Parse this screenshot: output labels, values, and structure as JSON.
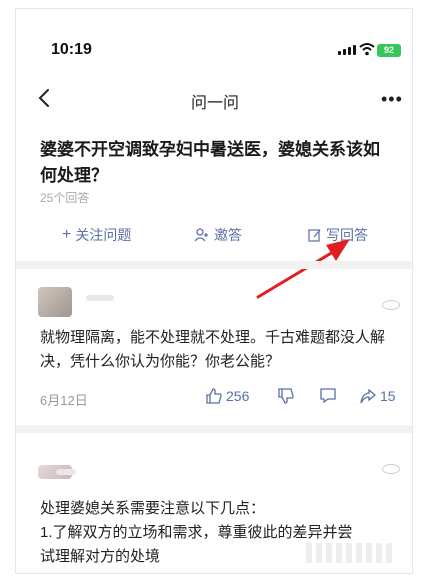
{
  "status": {
    "time": "10:19",
    "battery": "92"
  },
  "nav": {
    "title": "问一问",
    "more": "•••"
  },
  "question": {
    "title": "婆婆不开空调致孕妇中暑送医，婆媳关系该如何处理？",
    "answer_count": "25个回答"
  },
  "actions": {
    "follow": "关注问题",
    "invite": "邀答",
    "write": "写回答"
  },
  "answers": [
    {
      "text": "就物理隔离，能不处理就不处理。千古难题都没人解决，凭什么你认为你能？你老公能？",
      "date": "6月12日",
      "likes": "256",
      "shares": "15"
    },
    {
      "text_line1": "处理婆媳关系需要注意以下几点：",
      "text_line2": "1.了解双方的立场和需求，尊重彼此的差异并尝",
      "text_line3": "试理解对方的处境"
    }
  ],
  "colors": {
    "accent": "#5b6fa8",
    "arrow": "#e02020",
    "battery": "#35c759"
  }
}
